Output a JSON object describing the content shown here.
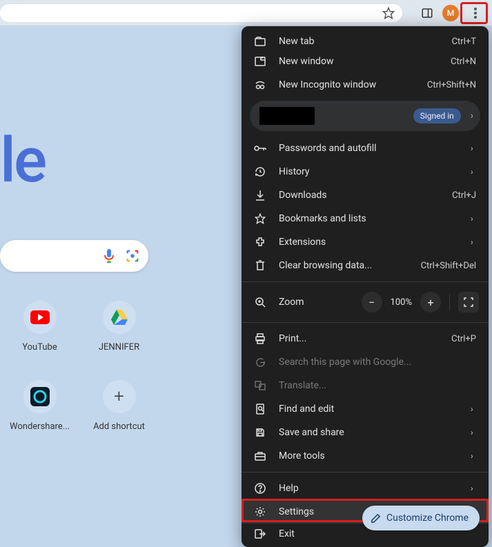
{
  "toolbar": {
    "avatar_letter": "M"
  },
  "logo_fragment": "le",
  "shortcuts": [
    {
      "label": "YouTube"
    },
    {
      "label": "JENNIFER"
    },
    {
      "label": "Wondershare..."
    },
    {
      "label": "Add shortcut"
    }
  ],
  "menu": {
    "new_tab": {
      "label": "New tab",
      "shortcut": "Ctrl+T"
    },
    "new_window": {
      "label": "New window",
      "shortcut": "Ctrl+N"
    },
    "new_incognito": {
      "label": "New Incognito window",
      "shortcut": "Ctrl+Shift+N"
    },
    "profile": {
      "signed_in": "Signed in"
    },
    "passwords": {
      "label": "Passwords and autofill"
    },
    "history": {
      "label": "History"
    },
    "downloads": {
      "label": "Downloads",
      "shortcut": "Ctrl+J"
    },
    "bookmarks": {
      "label": "Bookmarks and lists"
    },
    "extensions": {
      "label": "Extensions"
    },
    "clear": {
      "label": "Clear browsing data...",
      "shortcut": "Ctrl+Shift+Del"
    },
    "zoom": {
      "label": "Zoom",
      "value": "100%"
    },
    "print": {
      "label": "Print...",
      "shortcut": "Ctrl+P"
    },
    "search_page": {
      "label": "Search this page with Google..."
    },
    "translate": {
      "label": "Translate..."
    },
    "find": {
      "label": "Find and edit"
    },
    "save_share": {
      "label": "Save and share"
    },
    "more_tools": {
      "label": "More tools"
    },
    "help": {
      "label": "Help"
    },
    "settings": {
      "label": "Settings"
    },
    "exit": {
      "label": "Exit"
    }
  },
  "customize_label": "Customize Chrome"
}
